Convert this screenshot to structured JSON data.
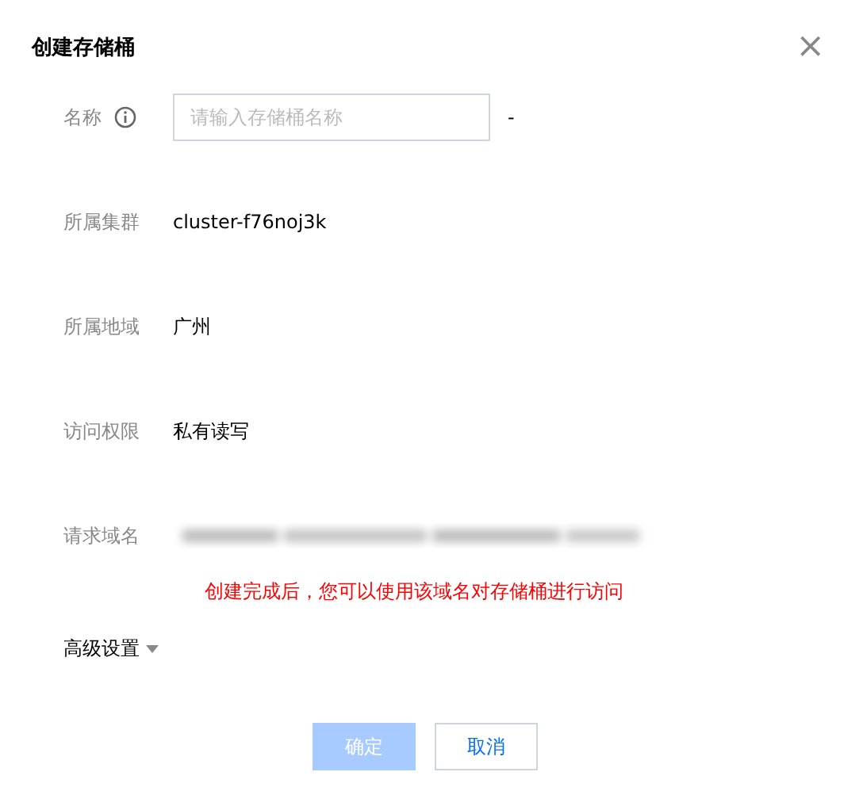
{
  "dialog": {
    "title": "创建存储桶",
    "close": "×"
  },
  "fields": [
    {
      "kind": "input",
      "label": "名称",
      "info": true,
      "placeholder": "请输入存储桶名称",
      "suffix": "-"
    },
    {
      "kind": "text",
      "label": "所属集群",
      "value": "cluster-f76noj3k"
    },
    {
      "kind": "text",
      "label": "所属地域",
      "value": "广州"
    },
    {
      "kind": "text",
      "label": "访问权限",
      "value": "私有读写"
    },
    {
      "kind": "redacted",
      "label": "请求域名"
    }
  ],
  "hint": "创建完成后，您可以使用该域名对存储桶进行访问",
  "advanced": {
    "label": "高级设置",
    "expanded": false
  },
  "buttons": [
    {
      "label": "确定",
      "kind": "primary",
      "disabled": true
    },
    {
      "label": "取消",
      "kind": "default",
      "disabled": false
    }
  ]
}
